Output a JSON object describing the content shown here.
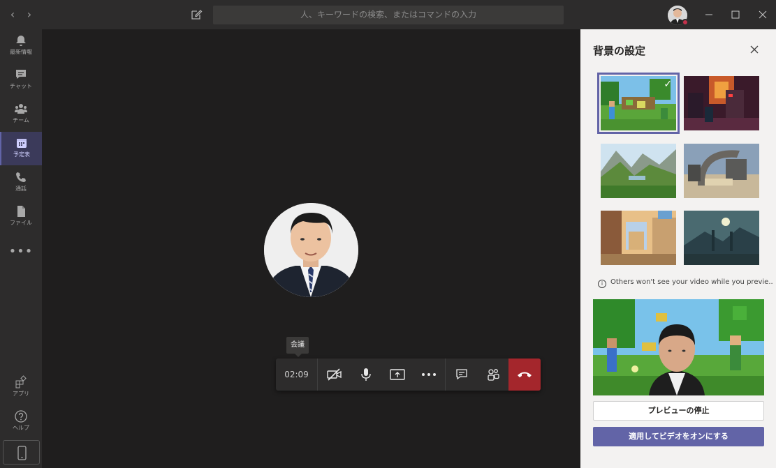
{
  "titlebar": {
    "search_placeholder": "人、キーワードの検索、またはコマンドの入力",
    "back": "‹",
    "forward": "›"
  },
  "rail": {
    "items": [
      {
        "label": "最新情報",
        "icon": "bell-icon"
      },
      {
        "label": "チャット",
        "icon": "chat-icon"
      },
      {
        "label": "チーム",
        "icon": "teams-icon"
      },
      {
        "label": "予定表",
        "icon": "calendar-icon"
      },
      {
        "label": "通話",
        "icon": "phone-icon"
      },
      {
        "label": "ファイル",
        "icon": "file-icon"
      }
    ],
    "more": "•••",
    "apps_label": "アプリ",
    "help_label": "ヘルプ"
  },
  "call": {
    "tooltip": "会議",
    "timer": "02:09",
    "accent_color": "#6264a7",
    "hangup_color": "#a4262c"
  },
  "background_panel": {
    "title": "背景の設定",
    "info_text": "Others won't see your video while you previe...",
    "stop_preview_label": "プレビューの停止",
    "apply_label": "適用してビデオをオンにする",
    "selected_index": 0
  }
}
